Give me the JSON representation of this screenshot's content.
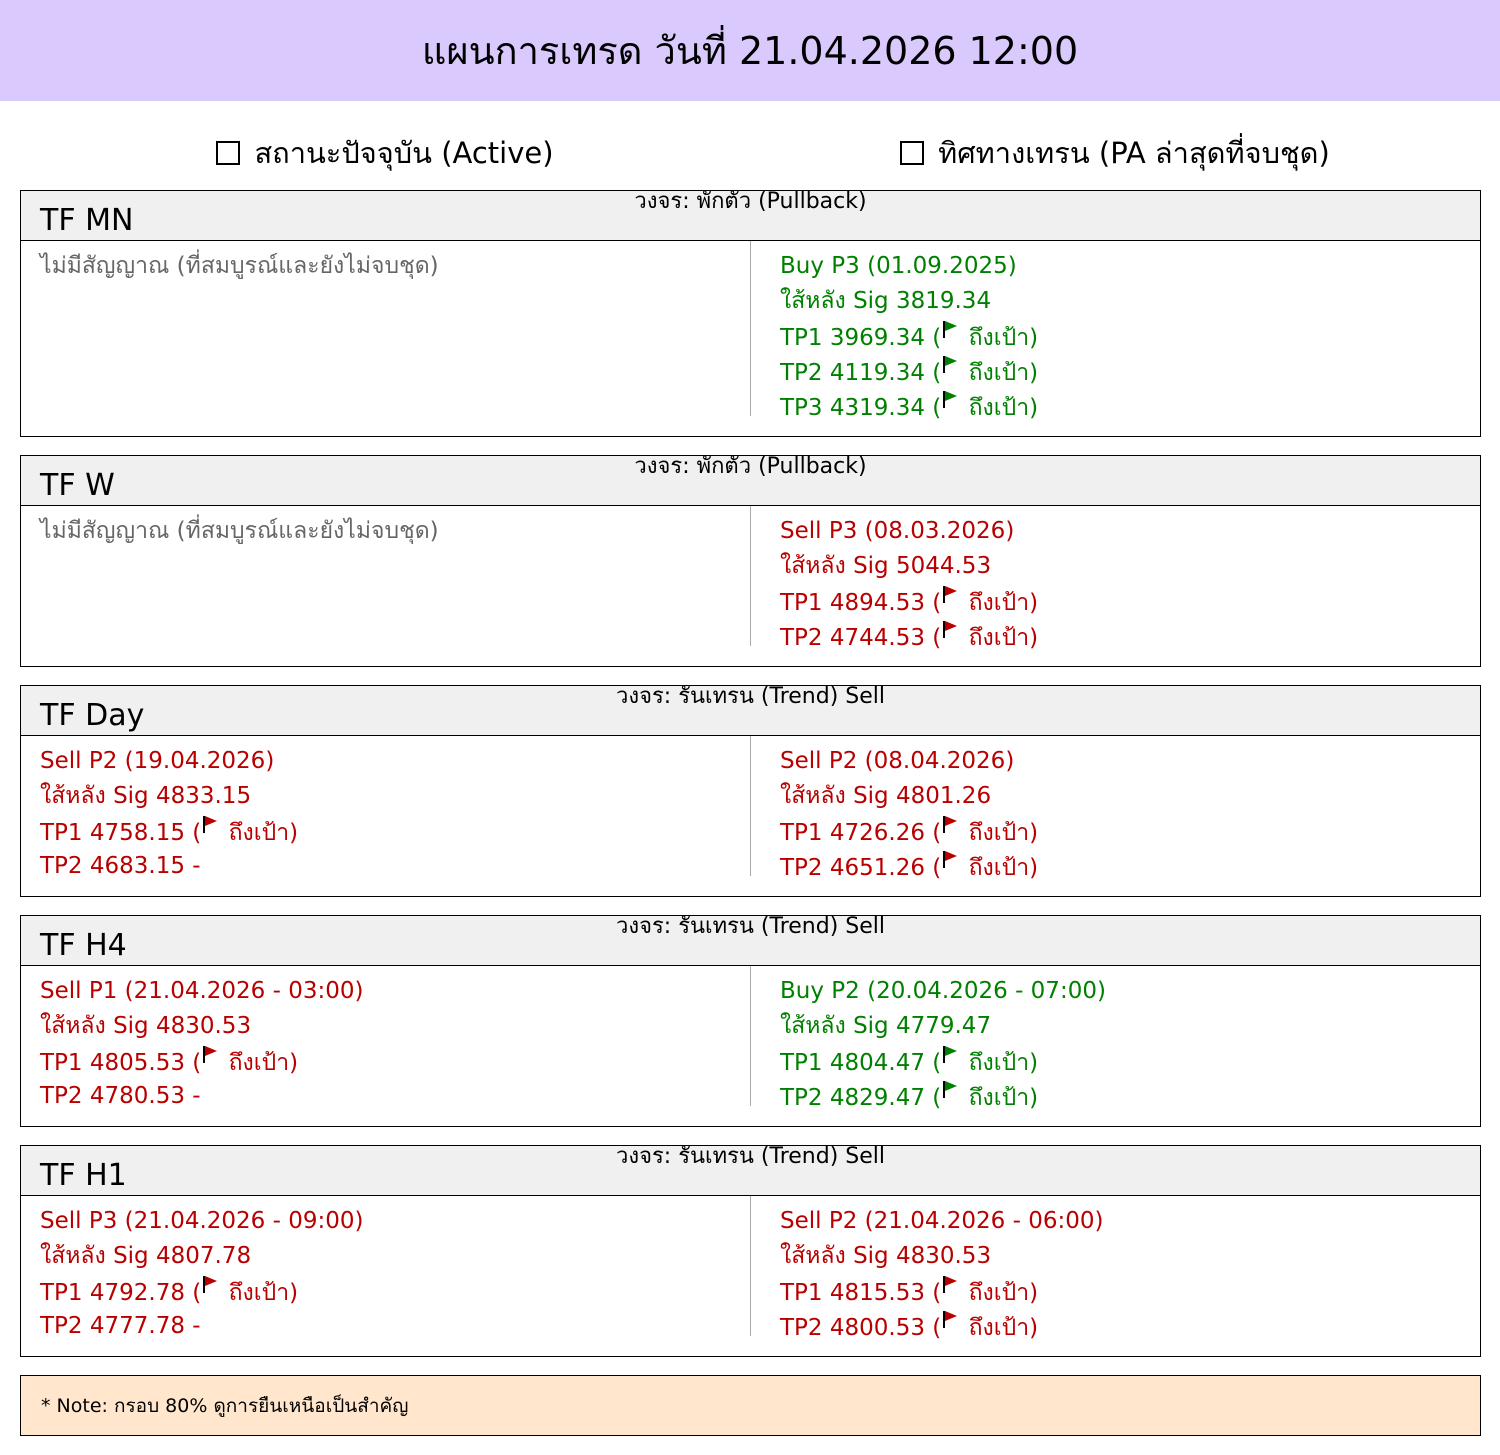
{
  "header": {
    "title": "แผนการเทรด วันที่ 21.04.2026 12:00"
  },
  "columns": {
    "left": "สถานะปัจจุบัน (Active)",
    "right": "ทิศทางเทรน (PA ล่าสุดที่จบชุด)"
  },
  "colors": {
    "buy": "#008000",
    "sell": "#b80000",
    "none": "#666666",
    "header_bg": "#dac9fd",
    "note_bg": "#ffe6cc"
  },
  "panels": [
    {
      "tf": "TF MN",
      "cycle": "วงจร: พักตัว (Pullback)",
      "left": [
        {
          "text": "ไม่มีสัญญาณ (ที่สมบูรณ์และยังไม่จบชุด)",
          "color": "gray"
        }
      ],
      "right": [
        {
          "text": "Buy P3 (01.09.2025)",
          "color": "green"
        },
        {
          "text": "ใส้หลัง Sig  3819.34",
          "color": "green"
        },
        {
          "text": "TP1 3969.34 (",
          "suffix": " ถึงเป้า)",
          "flag": true,
          "color": "green"
        },
        {
          "text": "TP2 4119.34 (",
          "suffix": " ถึงเป้า)",
          "flag": true,
          "color": "green"
        },
        {
          "text": "TP3 4319.34 (",
          "suffix": " ถึงเป้า)",
          "flag": true,
          "color": "green"
        }
      ]
    },
    {
      "tf": "TF W",
      "cycle": "วงจร: พักตัว (Pullback)",
      "left": [
        {
          "text": "ไม่มีสัญญาณ (ที่สมบูรณ์และยังไม่จบชุด)",
          "color": "gray"
        }
      ],
      "right": [
        {
          "text": "Sell P3 (08.03.2026)",
          "color": "red"
        },
        {
          "text": "ใส้หลัง Sig  5044.53",
          "color": "red"
        },
        {
          "text": "TP1 4894.53 (",
          "suffix": " ถึงเป้า)",
          "flag": true,
          "color": "red"
        },
        {
          "text": "TP2 4744.53 (",
          "suffix": " ถึงเป้า)",
          "flag": true,
          "color": "red"
        }
      ]
    },
    {
      "tf": "TF Day",
      "cycle": "วงจร: รันเทรน (Trend) Sell",
      "left": [
        {
          "text": "Sell P2 (19.04.2026)",
          "color": "red"
        },
        {
          "text": "ใส้หลัง Sig  4833.15",
          "color": "red"
        },
        {
          "text": "TP1 4758.15 (",
          "suffix": " ถึงเป้า)",
          "flag": true,
          "color": "red"
        },
        {
          "text": "TP2 4683.15  -",
          "color": "red"
        }
      ],
      "right": [
        {
          "text": "Sell P2 (08.04.2026)",
          "color": "red"
        },
        {
          "text": "ใส้หลัง Sig  4801.26",
          "color": "red"
        },
        {
          "text": "TP1 4726.26 (",
          "suffix": " ถึงเป้า)",
          "flag": true,
          "color": "red"
        },
        {
          "text": "TP2 4651.26 (",
          "suffix": " ถึงเป้า)",
          "flag": true,
          "color": "red"
        }
      ]
    },
    {
      "tf": "TF H4",
      "cycle": "วงจร: รันเทรน (Trend) Sell",
      "left": [
        {
          "text": "Sell P1 (21.04.2026 - 03:00)",
          "color": "red"
        },
        {
          "text": "ใส้หลัง Sig  4830.53",
          "color": "red"
        },
        {
          "text": "TP1 4805.53 (",
          "suffix": " ถึงเป้า)",
          "flag": true,
          "color": "red"
        },
        {
          "text": "TP2 4780.53  -",
          "color": "red"
        }
      ],
      "right": [
        {
          "text": "Buy P2 (20.04.2026 - 07:00)",
          "color": "green"
        },
        {
          "text": "ใส้หลัง Sig  4779.47",
          "color": "green"
        },
        {
          "text": "TP1 4804.47 (",
          "suffix": " ถึงเป้า)",
          "flag": true,
          "color": "green"
        },
        {
          "text": "TP2 4829.47 (",
          "suffix": " ถึงเป้า)",
          "flag": true,
          "color": "green"
        }
      ]
    },
    {
      "tf": "TF H1",
      "cycle": "วงจร: รันเทรน (Trend) Sell",
      "left": [
        {
          "text": "Sell P3 (21.04.2026 - 09:00)",
          "color": "red"
        },
        {
          "text": "ใส้หลัง Sig  4807.78",
          "color": "red"
        },
        {
          "text": "TP1 4792.78 (",
          "suffix": " ถึงเป้า)",
          "flag": true,
          "color": "red"
        },
        {
          "text": "TP2 4777.78  -",
          "color": "red"
        }
      ],
      "right": [
        {
          "text": "Sell P2 (21.04.2026 - 06:00)",
          "color": "red"
        },
        {
          "text": "ใส้หลัง Sig  4830.53",
          "color": "red"
        },
        {
          "text": "TP1 4815.53 (",
          "suffix": " ถึงเป้า)",
          "flag": true,
          "color": "red"
        },
        {
          "text": "TP2 4800.53 (",
          "suffix": " ถึงเป้า)",
          "flag": true,
          "color": "red"
        }
      ]
    }
  ],
  "note": "* Note: กรอบ 80% ดูการยืนเหนือเป็นสำคัญ"
}
